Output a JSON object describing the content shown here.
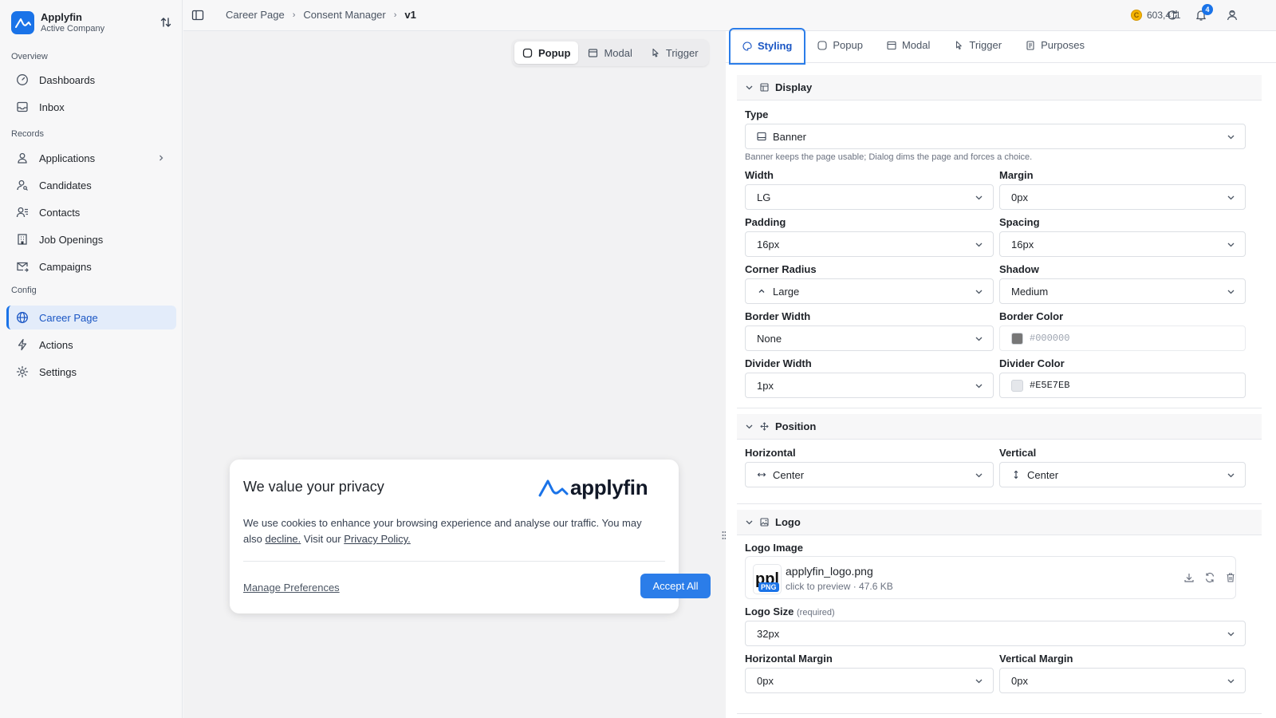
{
  "brand": {
    "name": "Applyfin",
    "subtitle": "Active Company"
  },
  "sidebar": {
    "sections": {
      "overview": "Overview",
      "records": "Records",
      "config": "Config"
    },
    "items": {
      "dashboards": "Dashboards",
      "inbox": "Inbox",
      "applications": "Applications",
      "candidates": "Candidates",
      "contacts": "Contacts",
      "job_openings": "Job Openings",
      "campaigns": "Campaigns",
      "career_page": "Career Page",
      "actions": "Actions",
      "settings": "Settings"
    },
    "active": "Career Page"
  },
  "breadcrumb": {
    "items": [
      "Career Page",
      "Consent Manager",
      "v1"
    ],
    "separator": "›"
  },
  "topbar": {
    "credits": "603,411",
    "coin_symbol": "C",
    "notifications": "4"
  },
  "preview_switcher": {
    "items": [
      "Popup",
      "Modal",
      "Trigger"
    ],
    "active": "Popup"
  },
  "popup": {
    "title": "We value your privacy",
    "logo_text": "applyfin",
    "body_prefix": "We use cookies to enhance your browsing experience and analyse our traffic.  You may also ",
    "decline_link": "decline.",
    "body_mid": " Visit our ",
    "privacy_link": "Privacy Policy.",
    "manage_link": "Manage Preferences",
    "accept_button": "Accept All"
  },
  "panel": {
    "tabs": [
      "Styling",
      "Popup",
      "Modal",
      "Trigger",
      "Purposes"
    ],
    "active_tab": "Styling",
    "display": {
      "header": "Display",
      "type_label": "Type",
      "type_value": "Banner",
      "type_hint": "Banner keeps the page usable; Dialog dims the page and forces a choice.",
      "width_label": "Width",
      "width_value": "LG",
      "margin_label": "Margin",
      "margin_value": "0px",
      "padding_label": "Padding",
      "padding_value": "16px",
      "spacing_label": "Spacing",
      "spacing_value": "16px",
      "corner_label": "Corner Radius",
      "corner_value": "Large",
      "shadow_label": "Shadow",
      "shadow_value": "Medium",
      "border_width_label": "Border Width",
      "border_width_value": "None",
      "border_color_label": "Border Color",
      "border_color_placeholder": "#000000",
      "border_color_swatch": "#777777",
      "divider_width_label": "Divider Width",
      "divider_width_value": "1px",
      "divider_color_label": "Divider Color",
      "divider_color_value": "#E5E7EB"
    },
    "position": {
      "header": "Position",
      "horizontal_label": "Horizontal",
      "horizontal_value": "Center",
      "vertical_label": "Vertical",
      "vertical_value": "Center"
    },
    "logo": {
      "header": "Logo",
      "image_label": "Logo Image",
      "file_name": "applyfin_logo.png",
      "file_thumb_text": "ppl",
      "file_type": "PNG",
      "file_meta": "click to preview  ·  47.6 KB",
      "size_label": "Logo Size",
      "size_required": "(required)",
      "size_value": "32px",
      "hmargin_label": "Horizontal Margin",
      "hmargin_value": "0px",
      "vmargin_label": "Vertical Margin",
      "vmargin_value": "0px"
    }
  },
  "colors": {
    "accent": "#1a73e8",
    "active_nav_bg": "#e3ecfa",
    "accept_button": "#2b7de9"
  }
}
